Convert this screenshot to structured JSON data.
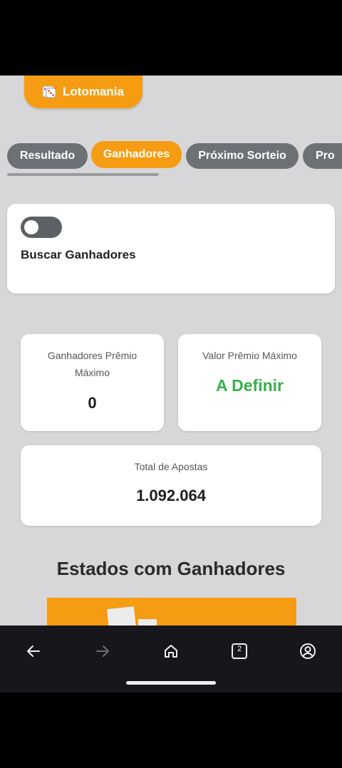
{
  "app": {
    "brand_label": "Lotomania"
  },
  "tabs": [
    {
      "label": "Resultado",
      "active": false
    },
    {
      "label": "Ganhadores",
      "active": true
    },
    {
      "label": "Próximo Sorteio",
      "active": false
    },
    {
      "label": "Pro",
      "active": false
    }
  ],
  "search": {
    "label": "Buscar Ganhadores",
    "toggle_on": false
  },
  "stats": {
    "winners_label": "Ganhadores Prêmio Máximo",
    "winners_value": "0",
    "prize_label": "Valor Prêmio Máximo",
    "prize_value": "A Definir",
    "bets_label": "Total de Apostas",
    "bets_value": "1.092.064"
  },
  "section": {
    "title": "Estados com Ganhadores"
  },
  "navbar": {
    "icons": [
      "back-arrow-icon",
      "forward-arrow-icon",
      "home-icon",
      "tabs-icon",
      "account-icon"
    ],
    "tabs_count": "2"
  },
  "colors": {
    "accent": "#f59c12",
    "tab_inactive": "#6d7175",
    "prize_green": "#35b24a",
    "background": "#d7d7d9"
  }
}
